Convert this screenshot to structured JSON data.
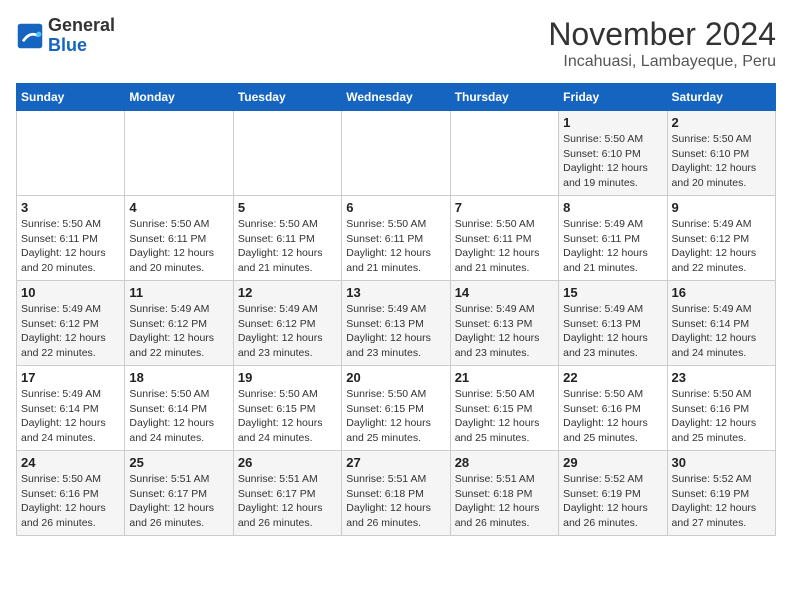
{
  "header": {
    "logo_general": "General",
    "logo_blue": "Blue",
    "month": "November 2024",
    "location": "Incahuasi, Lambayeque, Peru"
  },
  "weekdays": [
    "Sunday",
    "Monday",
    "Tuesday",
    "Wednesday",
    "Thursday",
    "Friday",
    "Saturday"
  ],
  "weeks": [
    [
      {
        "day": "",
        "info": ""
      },
      {
        "day": "",
        "info": ""
      },
      {
        "day": "",
        "info": ""
      },
      {
        "day": "",
        "info": ""
      },
      {
        "day": "",
        "info": ""
      },
      {
        "day": "1",
        "info": "Sunrise: 5:50 AM\nSunset: 6:10 PM\nDaylight: 12 hours and 19 minutes."
      },
      {
        "day": "2",
        "info": "Sunrise: 5:50 AM\nSunset: 6:10 PM\nDaylight: 12 hours and 20 minutes."
      }
    ],
    [
      {
        "day": "3",
        "info": "Sunrise: 5:50 AM\nSunset: 6:11 PM\nDaylight: 12 hours and 20 minutes."
      },
      {
        "day": "4",
        "info": "Sunrise: 5:50 AM\nSunset: 6:11 PM\nDaylight: 12 hours and 20 minutes."
      },
      {
        "day": "5",
        "info": "Sunrise: 5:50 AM\nSunset: 6:11 PM\nDaylight: 12 hours and 21 minutes."
      },
      {
        "day": "6",
        "info": "Sunrise: 5:50 AM\nSunset: 6:11 PM\nDaylight: 12 hours and 21 minutes."
      },
      {
        "day": "7",
        "info": "Sunrise: 5:50 AM\nSunset: 6:11 PM\nDaylight: 12 hours and 21 minutes."
      },
      {
        "day": "8",
        "info": "Sunrise: 5:49 AM\nSunset: 6:11 PM\nDaylight: 12 hours and 21 minutes."
      },
      {
        "day": "9",
        "info": "Sunrise: 5:49 AM\nSunset: 6:12 PM\nDaylight: 12 hours and 22 minutes."
      }
    ],
    [
      {
        "day": "10",
        "info": "Sunrise: 5:49 AM\nSunset: 6:12 PM\nDaylight: 12 hours and 22 minutes."
      },
      {
        "day": "11",
        "info": "Sunrise: 5:49 AM\nSunset: 6:12 PM\nDaylight: 12 hours and 22 minutes."
      },
      {
        "day": "12",
        "info": "Sunrise: 5:49 AM\nSunset: 6:12 PM\nDaylight: 12 hours and 23 minutes."
      },
      {
        "day": "13",
        "info": "Sunrise: 5:49 AM\nSunset: 6:13 PM\nDaylight: 12 hours and 23 minutes."
      },
      {
        "day": "14",
        "info": "Sunrise: 5:49 AM\nSunset: 6:13 PM\nDaylight: 12 hours and 23 minutes."
      },
      {
        "day": "15",
        "info": "Sunrise: 5:49 AM\nSunset: 6:13 PM\nDaylight: 12 hours and 23 minutes."
      },
      {
        "day": "16",
        "info": "Sunrise: 5:49 AM\nSunset: 6:14 PM\nDaylight: 12 hours and 24 minutes."
      }
    ],
    [
      {
        "day": "17",
        "info": "Sunrise: 5:49 AM\nSunset: 6:14 PM\nDaylight: 12 hours and 24 minutes."
      },
      {
        "day": "18",
        "info": "Sunrise: 5:50 AM\nSunset: 6:14 PM\nDaylight: 12 hours and 24 minutes."
      },
      {
        "day": "19",
        "info": "Sunrise: 5:50 AM\nSunset: 6:15 PM\nDaylight: 12 hours and 24 minutes."
      },
      {
        "day": "20",
        "info": "Sunrise: 5:50 AM\nSunset: 6:15 PM\nDaylight: 12 hours and 25 minutes."
      },
      {
        "day": "21",
        "info": "Sunrise: 5:50 AM\nSunset: 6:15 PM\nDaylight: 12 hours and 25 minutes."
      },
      {
        "day": "22",
        "info": "Sunrise: 5:50 AM\nSunset: 6:16 PM\nDaylight: 12 hours and 25 minutes."
      },
      {
        "day": "23",
        "info": "Sunrise: 5:50 AM\nSunset: 6:16 PM\nDaylight: 12 hours and 25 minutes."
      }
    ],
    [
      {
        "day": "24",
        "info": "Sunrise: 5:50 AM\nSunset: 6:16 PM\nDaylight: 12 hours and 26 minutes."
      },
      {
        "day": "25",
        "info": "Sunrise: 5:51 AM\nSunset: 6:17 PM\nDaylight: 12 hours and 26 minutes."
      },
      {
        "day": "26",
        "info": "Sunrise: 5:51 AM\nSunset: 6:17 PM\nDaylight: 12 hours and 26 minutes."
      },
      {
        "day": "27",
        "info": "Sunrise: 5:51 AM\nSunset: 6:18 PM\nDaylight: 12 hours and 26 minutes."
      },
      {
        "day": "28",
        "info": "Sunrise: 5:51 AM\nSunset: 6:18 PM\nDaylight: 12 hours and 26 minutes."
      },
      {
        "day": "29",
        "info": "Sunrise: 5:52 AM\nSunset: 6:19 PM\nDaylight: 12 hours and 26 minutes."
      },
      {
        "day": "30",
        "info": "Sunrise: 5:52 AM\nSunset: 6:19 PM\nDaylight: 12 hours and 27 minutes."
      }
    ]
  ]
}
